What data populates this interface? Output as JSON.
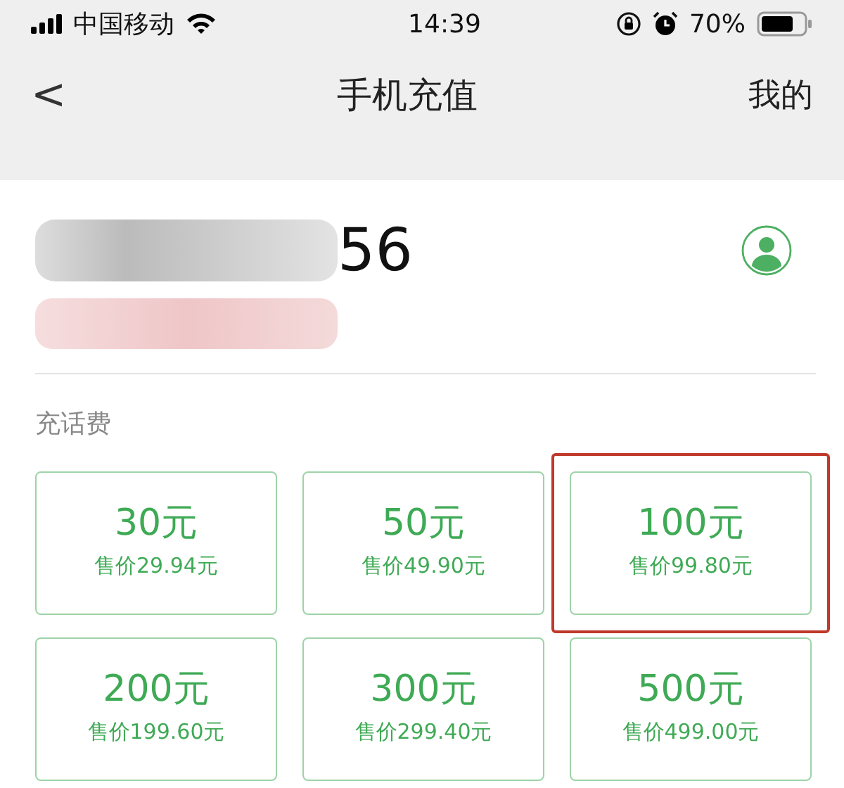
{
  "status_bar": {
    "carrier": "中国移动",
    "time": "14:39",
    "battery": "70%"
  },
  "nav": {
    "back": "<",
    "title": "手机充值",
    "action": "我的"
  },
  "account": {
    "number_visible": "56"
  },
  "section": {
    "title": "充话费"
  },
  "plans": [
    {
      "amount": "30元",
      "price": "售价29.94元",
      "highlighted": false
    },
    {
      "amount": "50元",
      "price": "售价49.90元",
      "highlighted": false
    },
    {
      "amount": "100元",
      "price": "售价99.80元",
      "highlighted": true
    },
    {
      "amount": "200元",
      "price": "售价199.60元",
      "highlighted": false
    },
    {
      "amount": "300元",
      "price": "售价299.40元",
      "highlighted": false
    },
    {
      "amount": "500元",
      "price": "售价499.00元",
      "highlighted": false
    }
  ]
}
